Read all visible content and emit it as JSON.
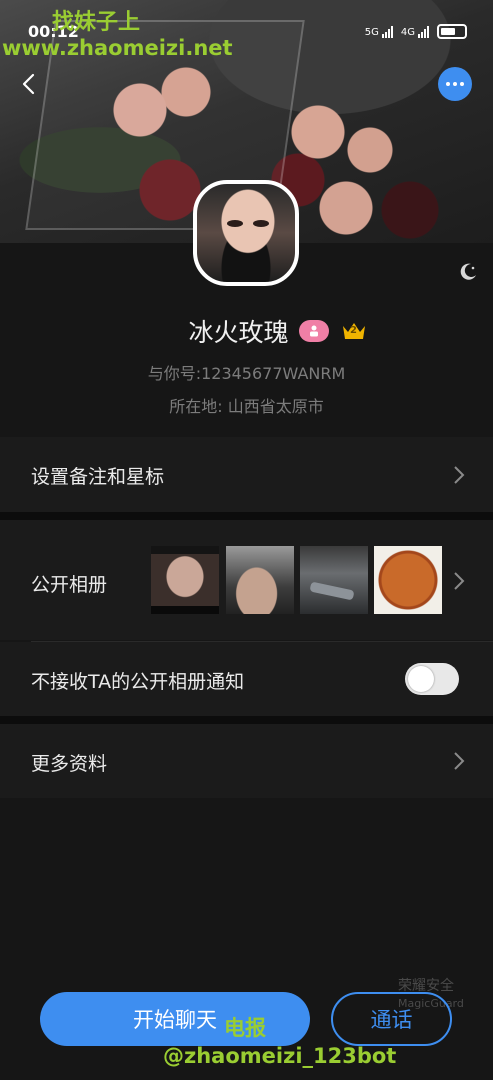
{
  "status_bar": {
    "time": "00:12",
    "signal_1": "5G",
    "signal_2": "4G"
  },
  "watermarks": {
    "top_text": "找妹子上",
    "url": "www.zhaomeizi.net",
    "telegram_label": "电报",
    "bot_handle": "@zhaomeizi_123bot"
  },
  "profile": {
    "name": "冰火玫瑰",
    "vip_level": "2",
    "id_line": "与你号:12345677WANRM",
    "location_line": "所在地: 山西省太原市"
  },
  "rows": {
    "remark_label": "设置备注和星标",
    "album_label": "公开相册",
    "album_notify_label": "不接收TA的公开相册通知",
    "more_info_label": "更多资料"
  },
  "album_notify_enabled": false,
  "guard": {
    "title": "荣耀安全",
    "sub": "MagicGuard"
  },
  "actions": {
    "chat_label": "开始聊天",
    "call_label": "通话"
  },
  "colors": {
    "accent": "#3e8ef0",
    "background": "#161616",
    "gender_badge": "#f07fa6",
    "vip_badge": "#f0b400",
    "watermark": "#9acd32"
  },
  "icons": [
    "back-arrow-icon",
    "more-dots-icon",
    "theme-moon-icon",
    "female-icon",
    "crown-icon",
    "chevron-right-icon"
  ]
}
